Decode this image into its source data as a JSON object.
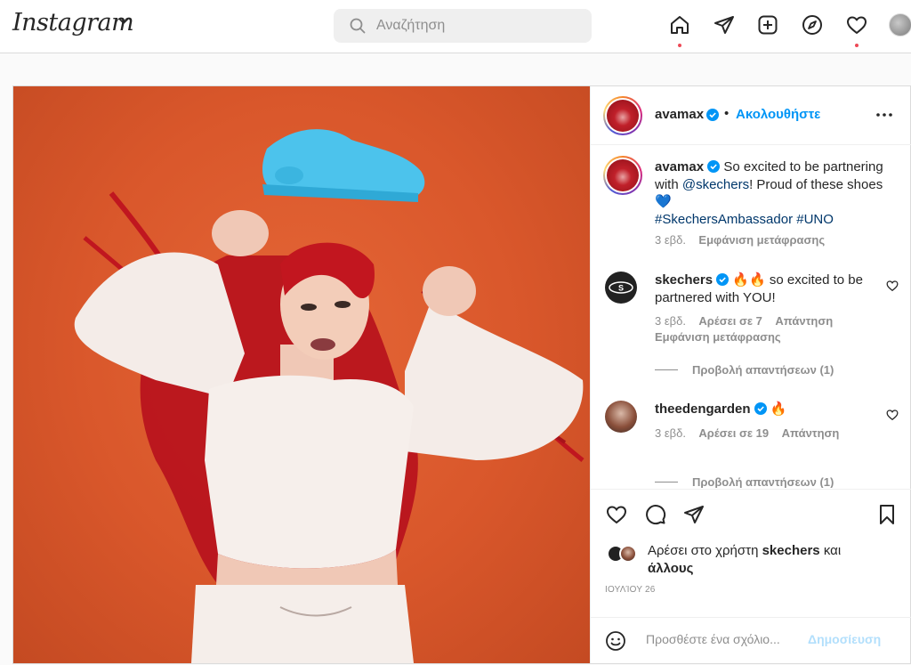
{
  "app": {
    "logo": "Instagram"
  },
  "nav": {
    "search_placeholder": "Αναζήτηση",
    "icons": [
      "home-icon",
      "direct-icon",
      "new-post-icon",
      "explore-icon",
      "activity-icon",
      "profile-avatar"
    ]
  },
  "post": {
    "author": "avamax",
    "follow_label": "Ακολουθήστε",
    "caption": {
      "user": "avamax",
      "text_1": "So excited to be partnering with ",
      "mention": "@skechers",
      "text_2": "! Proud of these shoes 💙",
      "hashtags": "#SkechersAmbassador #UNO",
      "time": "3 εβδ.",
      "translate": "Εμφάνιση μετάφρασης"
    },
    "comments": [
      {
        "user": "skechers",
        "text": "🔥🔥 so excited to be partnered with YOU!",
        "time": "3 εβδ.",
        "likes": "Αρέσει σε 7",
        "reply": "Απάντηση",
        "translate": "Εμφάνιση μετάφρασης",
        "view_replies": "Προβολή απαντήσεων (1)"
      },
      {
        "user": "theedengarden",
        "text": "🔥",
        "time": "3 εβδ.",
        "likes": "Αρέσει σε 19",
        "reply": "Απάντηση",
        "view_replies": "Προβολή απαντήσεων (1)"
      }
    ],
    "liked_by": {
      "prefix": "Αρέσει στο χρήστη ",
      "user": "skechers",
      "middle": " και ",
      "others": "άλλους"
    },
    "date": "ΙΟΥΛΊΟΥ 26",
    "add_comment_placeholder": "Προσθέστε ένα σχόλιο...",
    "publish_label": "Δημοσίευση"
  },
  "colors": {
    "accent": "#0095f6",
    "notification": "#ed4956",
    "background_orange": "#d9572b",
    "shoe": "#4cc3ec",
    "hair": "#d01f27"
  }
}
